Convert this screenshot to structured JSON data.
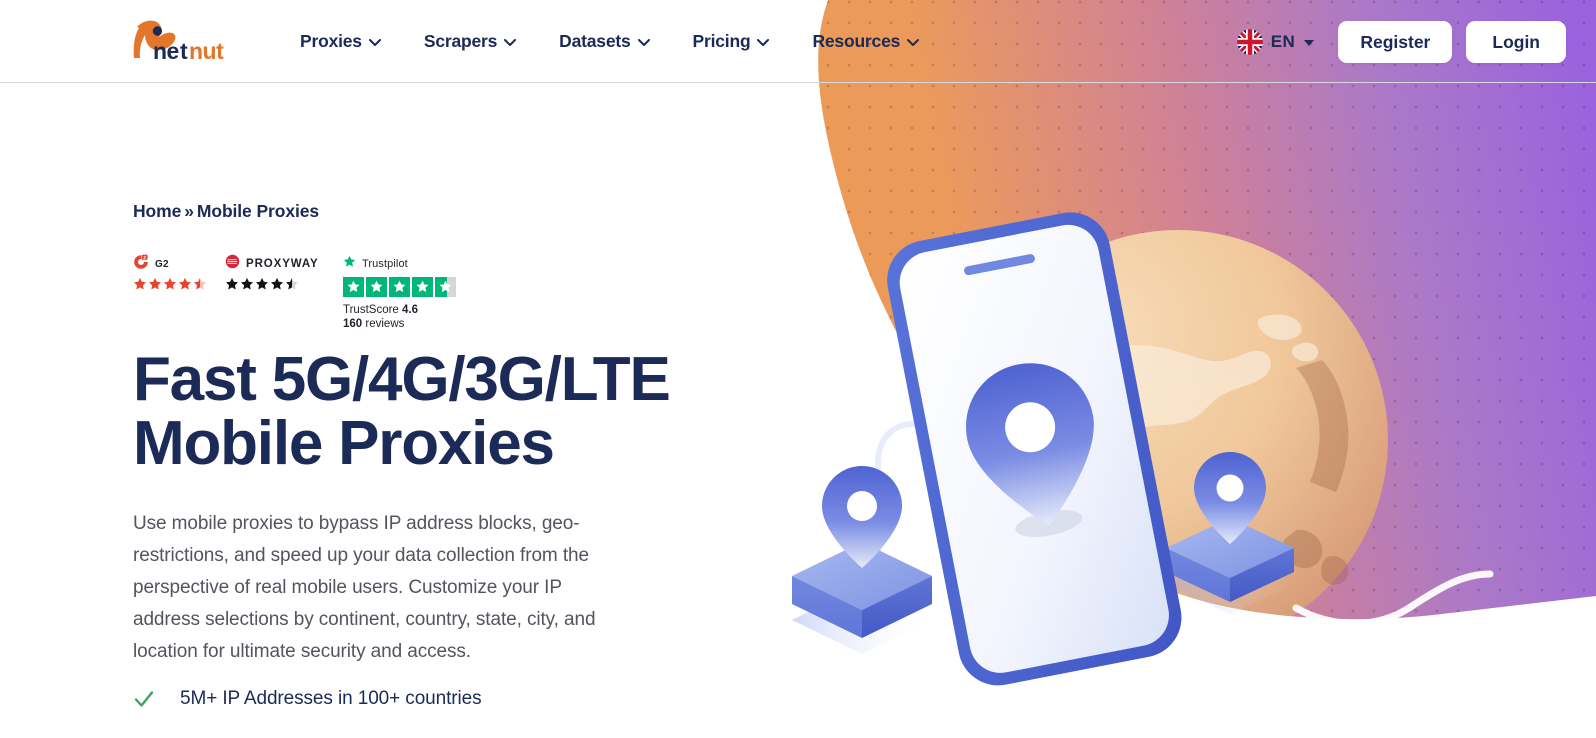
{
  "header": {
    "logo_text": "netnut",
    "logo_icon": "netnut-squirrel-logo",
    "nav": [
      {
        "label": "Proxies",
        "icon": "chevron-down-icon"
      },
      {
        "label": "Scrapers",
        "icon": "chevron-down-icon"
      },
      {
        "label": "Datasets",
        "icon": "chevron-down-icon"
      },
      {
        "label": "Pricing",
        "icon": "chevron-down-icon"
      },
      {
        "label": "Resources",
        "icon": "chevron-down-icon"
      }
    ],
    "language": {
      "code": "EN",
      "flag_icon": "uk-flag-icon",
      "caret_icon": "caret-down-icon"
    },
    "register_label": "Register",
    "login_label": "Login"
  },
  "breadcrumb": {
    "home": "Home",
    "separator": "»",
    "current": "Mobile Proxies"
  },
  "badges": {
    "g2": {
      "name": "G2",
      "logo_icon": "g2-logo-icon",
      "rating": 4.5,
      "star_color": "#e8432e"
    },
    "proxyway": {
      "name": "PROXYWAY",
      "logo_icon": "proxyway-logo-icon",
      "rating": 4.5,
      "star_color": "#111111"
    },
    "trustpilot": {
      "name": "Trustpilot",
      "logo_icon": "trustpilot-star-icon",
      "rating": 4.6,
      "tiles": 5,
      "score_label": "TrustScore",
      "score_value": "4.6",
      "reviews_count": "160",
      "reviews_label": "reviews",
      "tile_color": "#00b67a"
    }
  },
  "hero": {
    "headline_line1": "Fast 5G/4G/3G/LTE",
    "headline_line2": "Mobile Proxies",
    "paragraph": "Use mobile proxies to bypass IP address blocks, geo-restrictions, and speed up your data collection from the perspective of real mobile users. Customize your IP address selections by continent, country, state, city, and location for ultimate security and access.",
    "features": [
      {
        "icon": "check-icon",
        "text": "5M+ IP Addresses in 100+ countries"
      }
    ],
    "illustration": {
      "name": "mobile-proxies-illustration",
      "elements": [
        "smartphone",
        "globe",
        "location-pin-left",
        "location-pin-right",
        "connector-cable"
      ]
    }
  },
  "colors": {
    "navy": "#1b2a56",
    "body_text": "#525560",
    "gradient_start": "#ef9b55",
    "gradient_end": "#9a68d8",
    "check_green": "#3fa460",
    "accent_orange": "#e2762a",
    "pin_blue": "#4f63d2"
  }
}
